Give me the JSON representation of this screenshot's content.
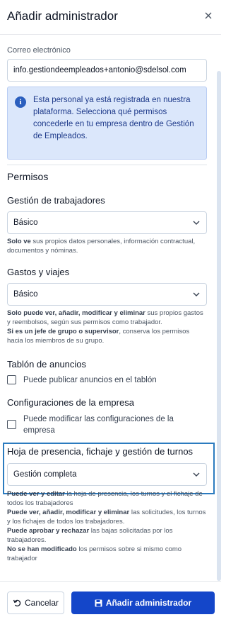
{
  "dialog": {
    "title": "Añadir administrador"
  },
  "email": {
    "label": "Correo electrónico",
    "value": "info.gestiondeempleados+antonio@sdelsol.com"
  },
  "info": {
    "text": "Esta personal ya está registrada en nuestra plataforma. Selecciona qué permisos concederle en tu empresa dentro de Gestión de Empleados."
  },
  "permisos": {
    "title": "Permisos",
    "trabajadores": {
      "title": "Gestión de trabajadores",
      "selected": "Básico",
      "help_bold": "Solo ve",
      "help_text": " sus propios datos personales, información contractual, documentos y nóminas."
    },
    "gastos": {
      "title": "Gastos y viajes",
      "selected": "Básico",
      "help1_bold": "Solo puede ver, añadir, modificar y eliminar",
      "help1_text": " sus propios gastos y reembolsos, según sus permisos como trabajador.",
      "help2_bold": "Si es un jefe de grupo o supervisor",
      "help2_text": ", conserva los permisos hacia los miembros de su grupo."
    },
    "tablon": {
      "title": "Tablón de anuncios",
      "checkbox_label": "Puede publicar anuncios en el tablón"
    },
    "configuraciones": {
      "title": "Configuraciones de la empresa",
      "checkbox_label": "Puede modificar las configuraciones de la empresa"
    },
    "presencia": {
      "title": "Hoja de presencia, fichaje y gestión de turnos",
      "selected": "Gestión completa",
      "help1_bold": "Puede ver y editar",
      "help1_text": " la hoja de presencia, los turnos y el fichaje de todos los trabajadores",
      "help2_bold": "Puede ver, añadir, modificar y eliminar",
      "help2_text": " las solicitudes, los turnos y los fichajes de todos los trabajadores.",
      "help3_bold": "Puede aprobar y rechazar",
      "help3_text": " las bajas solicitadas por los trabajadores.",
      "help4_bold": "No se han modificado",
      "help4_text": " los permisos sobre si mismo como trabajador"
    }
  },
  "footer": {
    "cancel_label": "Cancelar",
    "add_label": "Añadir administrador"
  },
  "icons": {
    "close": "close-icon",
    "info": "info-icon",
    "chevron": "chevron-down-icon",
    "undo": "undo-icon",
    "save": "save-icon"
  },
  "colors": {
    "primary": "#1446c9",
    "info_bg": "#dbe7fb",
    "highlight_border": "#2b7bbf"
  }
}
